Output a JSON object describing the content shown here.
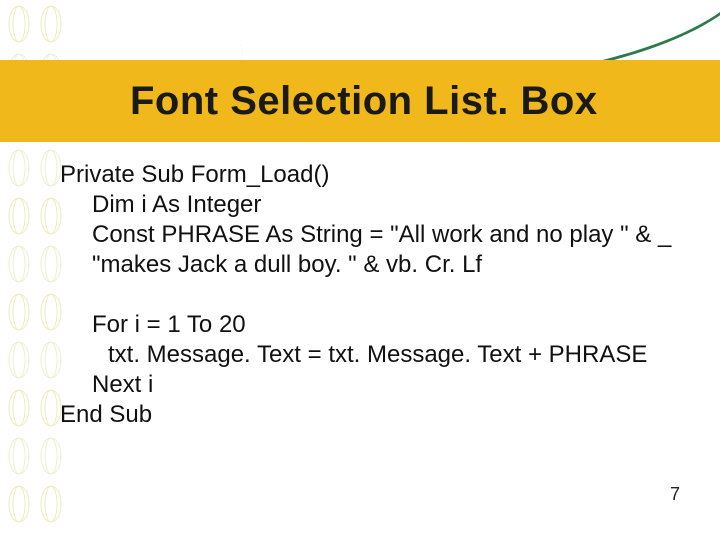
{
  "title": "Font Selection List. Box",
  "code": {
    "line1": "Private Sub Form_Load()",
    "line2": "Dim i As Integer",
    "line3": "Const PHRASE As String = \"All work and no play \"  &  _       \"makes Jack a dull boy. \" & vb. Cr. Lf",
    "line4": "For i = 1 To 20",
    "line5": "txt. Message. Text = txt. Message. Text + PHRASE",
    "line6": "Next i",
    "line7": "End Sub"
  },
  "page_number": "7"
}
